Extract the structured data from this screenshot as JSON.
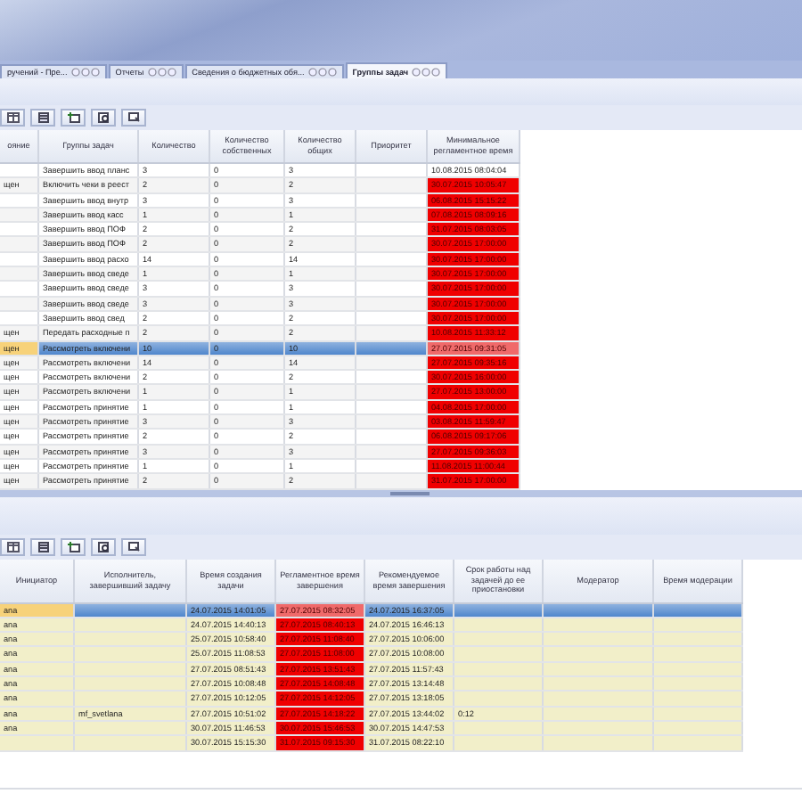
{
  "tabs": [
    {
      "label": "ручений - Пре...",
      "selected": false
    },
    {
      "label": "Отчеты",
      "selected": false
    },
    {
      "label": "Сведения о бюджетных обя...",
      "selected": false
    },
    {
      "label": "Группы задач",
      "selected": true
    }
  ],
  "top_table": {
    "columns": [
      "ояние",
      "Группы задач",
      "Количество",
      "Количество собственных",
      "Количество общих",
      "Приоритет",
      "Минимальное регламентное время"
    ],
    "rows": [
      {
        "cells": [
          "",
          "Завершить ввод планс",
          "3",
          "0",
          "3",
          "",
          "10.08.2015 08:04:04"
        ],
        "overdue": false,
        "selected": false
      },
      {
        "cells": [
          "щен",
          "Включить чеки в реест",
          "2",
          "0",
          "2",
          "",
          "30.07.2015 10:05:47"
        ],
        "overdue": true,
        "selected": false
      },
      {
        "cells": [
          "",
          "Завершить ввод внутр",
          "3",
          "0",
          "3",
          "",
          "06.08.2015 15:15:22"
        ],
        "overdue": true,
        "selected": false
      },
      {
        "cells": [
          "",
          "Завершить ввод касс",
          "1",
          "0",
          "1",
          "",
          "07.08.2015 08:09:16"
        ],
        "overdue": true,
        "selected": false
      },
      {
        "cells": [
          "",
          "Завершить ввод ПОФ",
          "2",
          "0",
          "2",
          "",
          "31.07.2015 08:03:05"
        ],
        "overdue": true,
        "selected": false
      },
      {
        "cells": [
          "",
          "Завершить ввод ПОФ",
          "2",
          "0",
          "2",
          "",
          "30.07.2015 17:00:00"
        ],
        "overdue": true,
        "selected": false
      },
      {
        "cells": [
          "",
          "Завершить ввод расхо",
          "14",
          "0",
          "14",
          "",
          "30.07.2015 17:00:00"
        ],
        "overdue": true,
        "selected": false
      },
      {
        "cells": [
          "",
          "Завершить ввод сведе",
          "1",
          "0",
          "1",
          "",
          "30.07.2015 17:00:00"
        ],
        "overdue": true,
        "selected": false
      },
      {
        "cells": [
          "",
          "Завершить ввод сведе",
          "3",
          "0",
          "3",
          "",
          "30.07.2015 17:00:00"
        ],
        "overdue": true,
        "selected": false
      },
      {
        "cells": [
          "",
          "Завершить ввод сведе",
          "3",
          "0",
          "3",
          "",
          "30.07.2015 17:00:00"
        ],
        "overdue": true,
        "selected": false
      },
      {
        "cells": [
          "",
          "Завершить ввод свед",
          "2",
          "0",
          "2",
          "",
          "30.07.2015 17:00:00"
        ],
        "overdue": true,
        "selected": false
      },
      {
        "cells": [
          "щен",
          "Передать расходные п",
          "2",
          "0",
          "2",
          "",
          "10.08.2015 11:33:12"
        ],
        "overdue": true,
        "selected": false
      },
      {
        "cells": [
          "щен",
          "Рассмотреть включени",
          "10",
          "0",
          "10",
          "",
          "27.07.2015 09:31:05"
        ],
        "overdue": true,
        "selected": true
      },
      {
        "cells": [
          "щен",
          "Рассмотреть включени",
          "14",
          "0",
          "14",
          "",
          "27.07.2015 09:35:16"
        ],
        "overdue": true,
        "selected": false
      },
      {
        "cells": [
          "щен",
          "Рассмотреть включени",
          "2",
          "0",
          "2",
          "",
          "30.07.2015 16:00:00"
        ],
        "overdue": true,
        "selected": false
      },
      {
        "cells": [
          "щен",
          "Рассмотреть включени",
          "1",
          "0",
          "1",
          "",
          "27.07.2015 13:00:00"
        ],
        "overdue": true,
        "selected": false
      },
      {
        "cells": [
          "щен",
          "Рассмотреть принятие",
          "1",
          "0",
          "1",
          "",
          "04.08.2015 17:00:00"
        ],
        "overdue": true,
        "selected": false
      },
      {
        "cells": [
          "щен",
          "Рассмотреть принятие",
          "3",
          "0",
          "3",
          "",
          "03.08.2015 11:59:47"
        ],
        "overdue": true,
        "selected": false
      },
      {
        "cells": [
          "щен",
          "Рассмотреть принятие",
          "2",
          "0",
          "2",
          "",
          "06.08.2015 09:17:06"
        ],
        "overdue": true,
        "selected": false
      },
      {
        "cells": [
          "щен",
          "Рассмотреть принятие",
          "3",
          "0",
          "3",
          "",
          "27.07.2015 09:36:03"
        ],
        "overdue": true,
        "selected": false
      },
      {
        "cells": [
          "щен",
          "Рассмотреть принятие",
          "1",
          "0",
          "1",
          "",
          "11.08.2015 11:00:44"
        ],
        "overdue": true,
        "selected": false
      },
      {
        "cells": [
          "щен",
          "Рассмотреть принятие",
          "2",
          "0",
          "2",
          "",
          "31.07.2015 17:00:00"
        ],
        "overdue": true,
        "selected": false
      }
    ]
  },
  "bottom_table": {
    "columns": [
      "Инициатор",
      "Исполнитель, завершивший задачу",
      "Время создания задачи",
      "Регламентное время завершения",
      "Рекомендуемое время завершения",
      "Срок работы над задачей до ее приостановки",
      "Модератор",
      "Время модерации"
    ],
    "rows": [
      {
        "cells": [
          "ana",
          "",
          "24.07.2015 14:01:05",
          "27.07.2015 08:32:05",
          "24.07.2015 16:37:05",
          "",
          "",
          ""
        ],
        "overdue": true,
        "selected": true
      },
      {
        "cells": [
          "ana",
          "",
          "24.07.2015 14:40:13",
          "27.07.2015 08:40:13",
          "24.07.2015 16:46:13",
          "",
          "",
          ""
        ],
        "overdue": true,
        "selected": false
      },
      {
        "cells": [
          "ana",
          "",
          "25.07.2015 10:58:40",
          "27.07.2015 11:08:40",
          "27.07.2015 10:06:00",
          "",
          "",
          ""
        ],
        "overdue": true,
        "selected": false
      },
      {
        "cells": [
          "ana",
          "",
          "25.07.2015 11:08:53",
          "27.07.2015 11:08:00",
          "27.07.2015 10:08:00",
          "",
          "",
          ""
        ],
        "overdue": true,
        "selected": false
      },
      {
        "cells": [
          "ana",
          "",
          "27.07.2015 08:51:43",
          "27.07.2015 13:51:43",
          "27.07.2015 11:57:43",
          "",
          "",
          ""
        ],
        "overdue": true,
        "selected": false
      },
      {
        "cells": [
          "ana",
          "",
          "27.07.2015 10:08:48",
          "27.07.2015 14:08:48",
          "27.07.2015 13:14:48",
          "",
          "",
          ""
        ],
        "overdue": true,
        "selected": false
      },
      {
        "cells": [
          "ana",
          "",
          "27.07.2015 10:12:05",
          "27.07.2015 14:12:05",
          "27.07.2015 13:18:05",
          "",
          "",
          ""
        ],
        "overdue": true,
        "selected": false
      },
      {
        "cells": [
          "ana",
          "mf_svetlana",
          "27.07.2015 10:51:02",
          "27.07.2015 14:18:22",
          "27.07.2015 13:44:02",
          "0:12",
          "",
          ""
        ],
        "overdue": true,
        "selected": false
      },
      {
        "cells": [
          "ana",
          "",
          "30.07.2015 11:46:53",
          "30.07.2015 15:46:53",
          "30.07.2015 14:47:53",
          "",
          "",
          ""
        ],
        "overdue": true,
        "selected": false
      },
      {
        "cells": [
          "",
          "",
          "30.07.2015 15:15:30",
          "31.07.2015 09:15:30",
          "31.07.2015 08:22:10",
          "",
          "",
          ""
        ],
        "overdue": true,
        "selected": false
      }
    ]
  }
}
